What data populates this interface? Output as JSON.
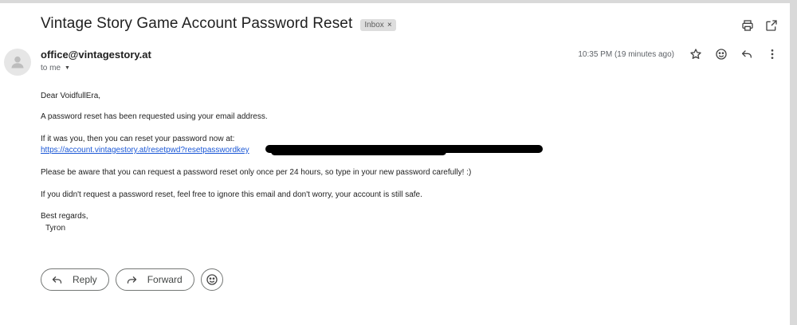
{
  "header": {
    "subject": "Vintage Story Game Account Password Reset",
    "label": "Inbox",
    "label_remove": "×",
    "icons": [
      "printer-icon",
      "open-in-new-window-icon"
    ]
  },
  "message": {
    "sender": "office@vintagestory.at",
    "recipient": "to me",
    "timestamp": "10:35 PM (19 minutes ago)",
    "header_icons": [
      "star-icon",
      "emoji-icon",
      "reply-icon",
      "more-vert-icon"
    ]
  },
  "body": {
    "greeting": "Dear VoidfullEra,",
    "para1": "A password reset has been requested using your email address.",
    "para2": "If it was you, then you can reset your password now at:",
    "link": "https://account.vintagestory.at/resetpwd?resetpasswordkey",
    "para3": "Please be aware that you can request a password reset only once per 24 hours, so type in your new password carefully! :)",
    "para4": "If you didn't request a password reset, feel free to ignore this email and don't worry, your account is still safe.",
    "closing": "Best regards,",
    "signature": "Tyron"
  },
  "actions": {
    "reply": "Reply",
    "forward": "Forward"
  }
}
